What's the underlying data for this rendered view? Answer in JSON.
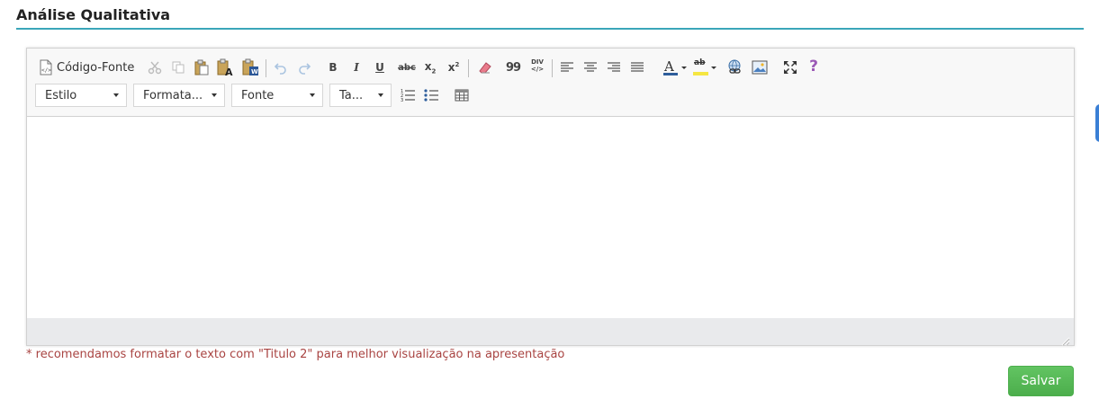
{
  "section": {
    "title": "Análise Qualitativa"
  },
  "toolbar": {
    "source_label": "Código-Fonte",
    "bold": "B",
    "italic": "I",
    "underline": "U",
    "strike": "abc",
    "subscript": "x",
    "superscript": "x",
    "blockquote": "99",
    "div_top": "DIV",
    "div_bottom": "</>",
    "text_color": "A",
    "bg_color": "ab",
    "help": "?"
  },
  "combos": {
    "style": "Estilo",
    "format": "Formata...",
    "font": "Fonte",
    "size": "Ta..."
  },
  "hint": "* recomendamos formatar o texto com \"Titulo 2\" para melhor visualização na apresentação",
  "actions": {
    "save": "Salvar"
  },
  "colors": {
    "accent_rule": "#3aa6b9",
    "save_green": "#5cb85c",
    "hint_red": "#a94442",
    "help_purple": "#9b59b6"
  },
  "icons": [
    "source-icon",
    "cut-icon",
    "copy-icon",
    "paste-icon",
    "paste-text-icon",
    "paste-word-icon",
    "undo-icon",
    "redo-icon",
    "bold-icon",
    "italic-icon",
    "underline-icon",
    "strike-icon",
    "subscript-icon",
    "superscript-icon",
    "remove-format-icon",
    "blockquote-icon",
    "div-icon",
    "align-left-icon",
    "align-center-icon",
    "align-right-icon",
    "justify-icon",
    "text-color-icon",
    "bg-color-icon",
    "link-icon",
    "image-icon",
    "maximize-icon",
    "help-icon",
    "numbered-list-icon",
    "bulleted-list-icon",
    "table-icon"
  ]
}
